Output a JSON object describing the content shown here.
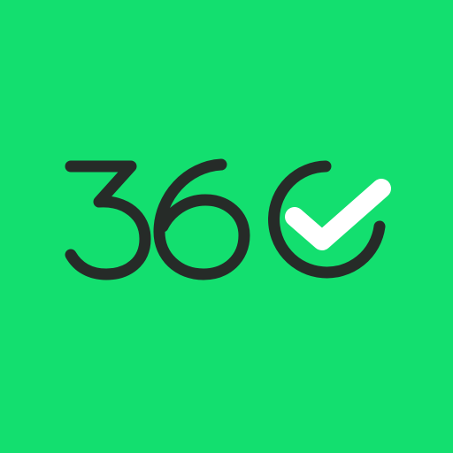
{
  "logo": {
    "text": "360",
    "background_color": "#13df6f",
    "stroke_color": "#262b28",
    "check_color": "#ffffff",
    "icons": [
      "digit-three-icon",
      "digit-six-icon",
      "ring-icon",
      "checkmark-icon"
    ]
  }
}
